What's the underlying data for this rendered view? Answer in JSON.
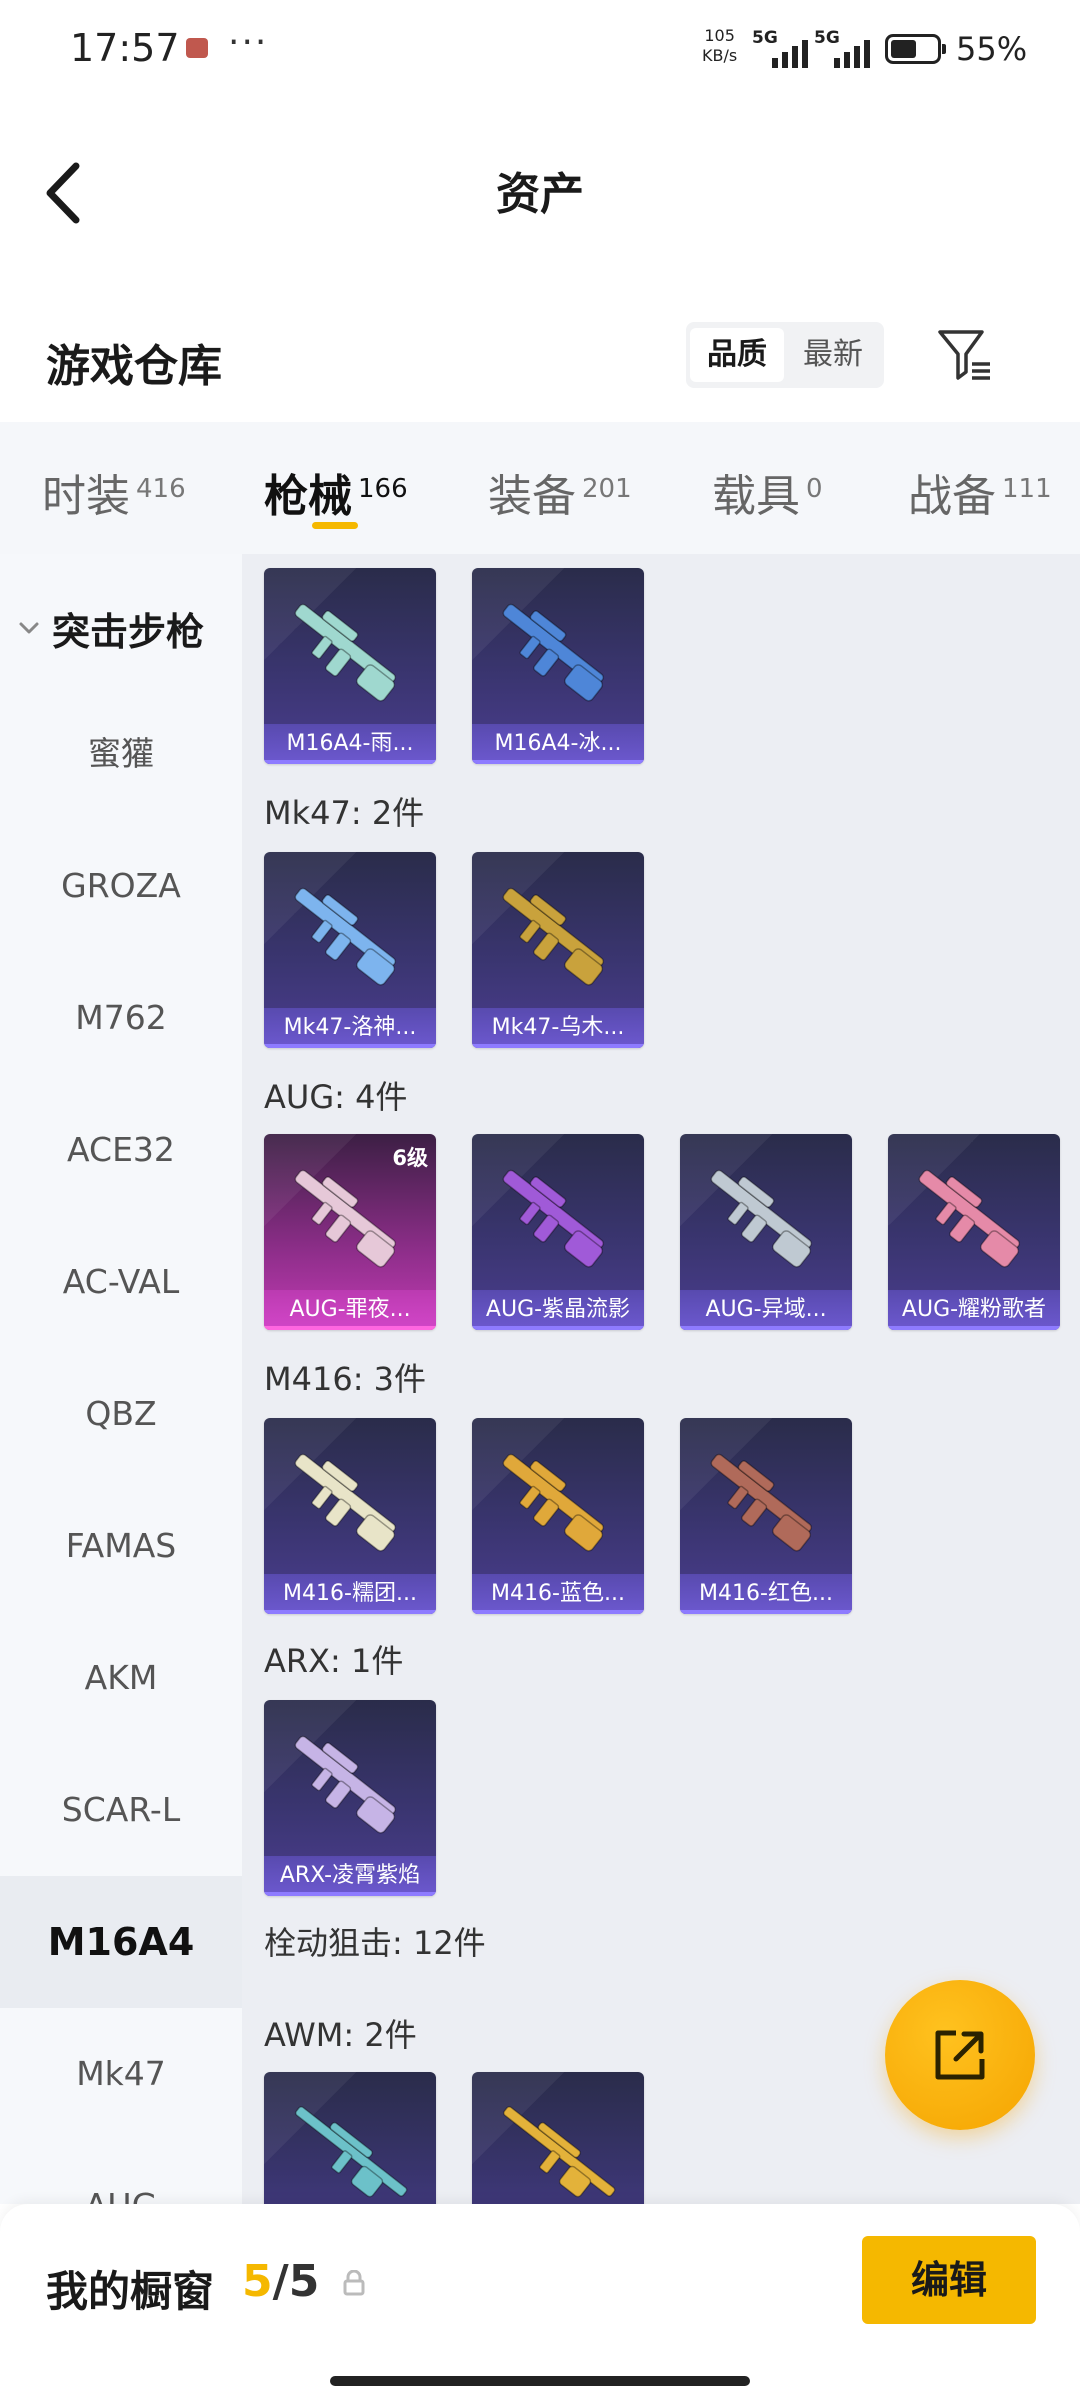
{
  "status_bar": {
    "time": "17:57",
    "net_speed_value": "105",
    "net_speed_unit": "KB/s",
    "sim1": "5G",
    "sim2": "5G",
    "battery": "55%"
  },
  "header": {
    "title": "资产"
  },
  "warehouse": {
    "title": "游戏仓库",
    "sort_options": [
      "品质",
      "最新"
    ],
    "sort_active": "品质"
  },
  "tabs": [
    {
      "label": "时装",
      "count": "416"
    },
    {
      "label": "枪械",
      "count": "166",
      "active": true
    },
    {
      "label": "装备",
      "count": "201"
    },
    {
      "label": "载具",
      "count": "0"
    },
    {
      "label": "战备",
      "count": "111"
    }
  ],
  "sidebar": {
    "category": "突击步枪",
    "items": [
      "蜜獾",
      "GROZA",
      "M762",
      "ACE32",
      "AC-VAL",
      "QBZ",
      "FAMAS",
      "AKM",
      "SCAR-L",
      "M16A4",
      "Mk47",
      "AUG"
    ],
    "active": "M16A4"
  },
  "groups": [
    {
      "title": "",
      "items": [
        {
          "name": "M16A4-雨...",
          "icon": "rifle-icon",
          "color": "#9fd8cf"
        },
        {
          "name": "M16A4-冰...",
          "icon": "rifle-icon",
          "color": "#4e86d8"
        }
      ]
    },
    {
      "title": "Mk47: 2件",
      "items": [
        {
          "name": "Mk47-洛神...",
          "icon": "rifle-icon",
          "color": "#7db4ee"
        },
        {
          "name": "Mk47-乌木...",
          "icon": "rifle-icon",
          "color": "#c9a23c"
        }
      ]
    },
    {
      "title": "AUG: 4件",
      "items": [
        {
          "name": "AUG-罪夜...",
          "icon": "rifle-icon",
          "color": "#e6c8d8",
          "level": "6级",
          "highlight": true
        },
        {
          "name": "AUG-紫晶流影",
          "icon": "rifle-icon",
          "color": "#a05ad8"
        },
        {
          "name": "AUG-异域...",
          "icon": "rifle-icon",
          "color": "#bfc9d2"
        },
        {
          "name": "AUG-耀粉歌者",
          "icon": "rifle-icon",
          "color": "#e58aa8"
        }
      ]
    },
    {
      "title": "M416: 3件",
      "items": [
        {
          "name": "M416-糯团...",
          "icon": "rifle-icon",
          "color": "#e8e4c8"
        },
        {
          "name": "M416-蓝色...",
          "icon": "rifle-icon",
          "color": "#e0a83a"
        },
        {
          "name": "M416-红色...",
          "icon": "rifle-icon",
          "color": "#b06a5a"
        }
      ]
    },
    {
      "title": "ARX: 1件",
      "items": [
        {
          "name": "ARX-凌霄紫焰",
          "icon": "rifle-icon",
          "color": "#c6b4e6"
        }
      ]
    },
    {
      "title": "栓动狙击: 12件",
      "items": []
    },
    {
      "title": "AWM: 2件",
      "items": [
        {
          "name": "",
          "icon": "sniper-icon",
          "color": "#6cc1c9"
        },
        {
          "name": "",
          "icon": "sniper-icon",
          "color": "#e3b23a"
        }
      ]
    }
  ],
  "showcase": {
    "label": "我的橱窗",
    "current": "5",
    "separator": "/",
    "total": "5",
    "edit_label": "编辑"
  },
  "colors": {
    "accent": "#f5b800",
    "card_bg": "#3a3570",
    "card_highlight": "#c23bb3"
  }
}
